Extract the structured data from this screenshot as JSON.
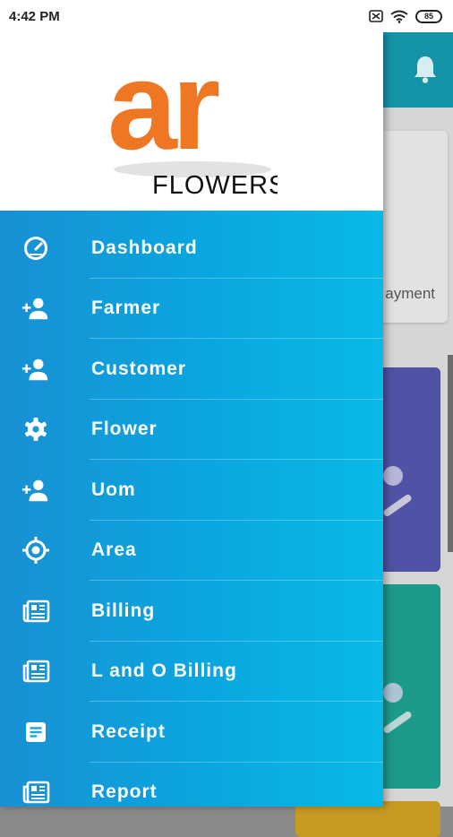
{
  "status_bar": {
    "time": "4:42 PM",
    "battery": "85"
  },
  "background": {
    "card_label": "ayment"
  },
  "brand": {
    "logo_text": "ar",
    "name": "FLOWERS"
  },
  "menu": [
    {
      "label": "Dashboard",
      "icon": "speedometer-icon"
    },
    {
      "label": "Farmer",
      "icon": "add-person-icon"
    },
    {
      "label": "Customer",
      "icon": "add-person-icon"
    },
    {
      "label": "Flower",
      "icon": "gear-icon"
    },
    {
      "label": "Uom",
      "icon": "add-person-icon"
    },
    {
      "label": "Area",
      "icon": "target-icon"
    },
    {
      "label": "Billing",
      "icon": "newspaper-icon"
    },
    {
      "label": "L and O Billing",
      "icon": "newspaper-icon"
    },
    {
      "label": "Receipt",
      "icon": "document-icon"
    },
    {
      "label": "Report",
      "icon": "newspaper-icon"
    }
  ],
  "colors": {
    "drawer_gradient_start": "#1890d4",
    "drawer_gradient_end": "#08b9e6",
    "logo_orange": "#ef7622",
    "header_teal": "#1593a7"
  }
}
